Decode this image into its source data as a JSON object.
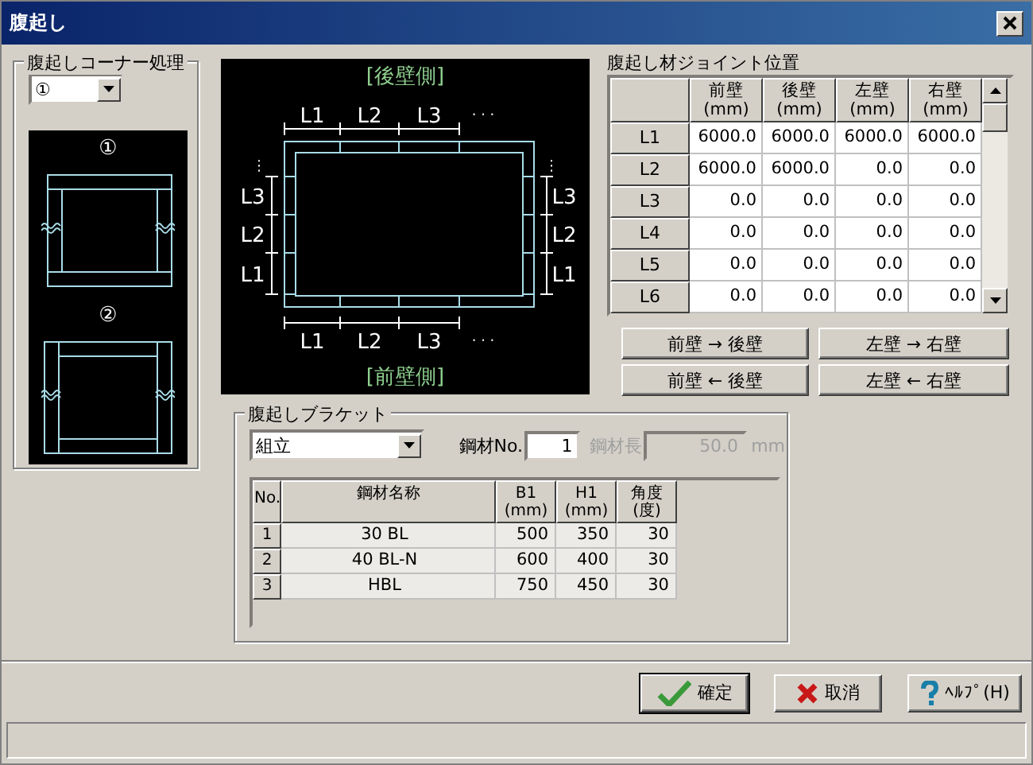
{
  "window": {
    "title": "腹起し"
  },
  "corner": {
    "label": "腹起しコーナー処理",
    "value": "①",
    "illustrations": [
      {
        "label": "①",
        "kind": "type1"
      },
      {
        "label": "②",
        "kind": "type2"
      }
    ]
  },
  "diagram": {
    "top_side": "[後壁側]",
    "bottom_side": "[前壁側]",
    "top_labels": [
      "L1",
      "L2",
      "L3"
    ],
    "bottom_labels": [
      "L1",
      "L2",
      "L3"
    ],
    "left_labels": [
      "L3",
      "L2",
      "L1"
    ],
    "right_labels": [
      "L3",
      "L2",
      "L1"
    ],
    "top_ellipsis": "· · ·",
    "bottom_ellipsis": "· · ·",
    "left_ellipsis": "⋮",
    "right_ellipsis": "⋮"
  },
  "joints": {
    "title": "腹起し材ジョイント位置",
    "columns": [
      {
        "name": "前壁",
        "unit": "(mm)"
      },
      {
        "name": "後壁",
        "unit": "(mm)"
      },
      {
        "name": "左壁",
        "unit": "(mm)"
      },
      {
        "name": "右壁",
        "unit": "(mm)"
      }
    ],
    "rows": [
      {
        "label": "L1",
        "values": [
          "6000.0",
          "6000.0",
          "6000.0",
          "6000.0"
        ]
      },
      {
        "label": "L2",
        "values": [
          "6000.0",
          "6000.0",
          "0.0",
          "0.0"
        ]
      },
      {
        "label": "L3",
        "values": [
          "0.0",
          "0.0",
          "0.0",
          "0.0"
        ]
      },
      {
        "label": "L4",
        "values": [
          "0.0",
          "0.0",
          "0.0",
          "0.0"
        ]
      },
      {
        "label": "L5",
        "values": [
          "0.0",
          "0.0",
          "0.0",
          "0.0"
        ]
      },
      {
        "label": "L6",
        "values": [
          "0.0",
          "0.0",
          "0.0",
          "0.0"
        ]
      }
    ]
  },
  "transfer_buttons": [
    "前壁 → 後壁",
    "左壁 → 右壁",
    "前壁 ← 後壁",
    "左壁 ← 右壁"
  ],
  "bracket": {
    "title": "腹起しブラケット",
    "type": "組立",
    "steel_no_label": "鋼材No.",
    "steel_no": "1",
    "length_label": "鋼材長",
    "length": "50.0",
    "length_unit": "mm",
    "length_disabled": true,
    "columns": [
      "No.",
      "鋼材名称",
      "B1\n(mm)",
      "H1\n(mm)",
      "角度\n(度)"
    ],
    "rows": [
      [
        "1",
        "30 BL",
        "500",
        "350",
        "30"
      ],
      [
        "2",
        "40 BL-N",
        "600",
        "400",
        "30"
      ],
      [
        "3",
        "HBL",
        "750",
        "450",
        "30"
      ]
    ]
  },
  "buttons": [
    {
      "label": "確定",
      "kind": "ok",
      "focused": true
    },
    {
      "label": "取消",
      "kind": "cancel",
      "focused": false
    },
    {
      "label": "ﾍﾙﾌﾟ(H)",
      "kind": "help",
      "focused": false
    }
  ]
}
